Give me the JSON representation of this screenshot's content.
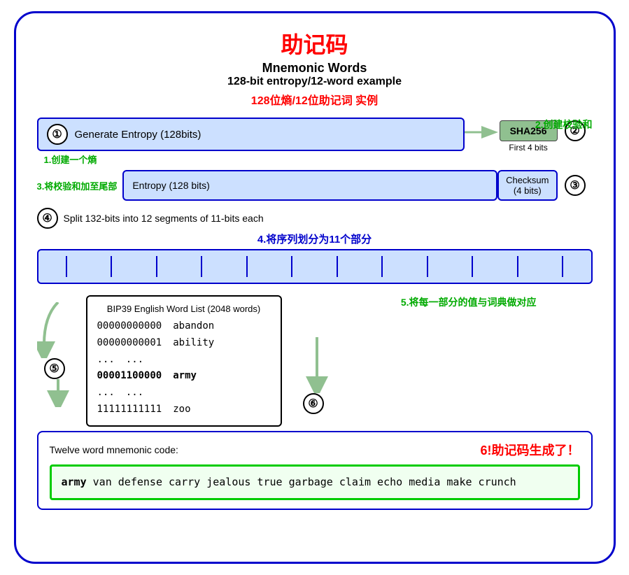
{
  "title": {
    "zh": "助记码",
    "en1": "Mnemonic Words",
    "en2": "128-bit entropy/12-word example",
    "zh2": "128位熵/12位助记词 实例"
  },
  "step1": {
    "number": "①",
    "label": "Generate Entropy (128bits)",
    "annotation": "1.创建一个熵"
  },
  "step2": {
    "number": "②",
    "sha_label": "SHA256",
    "first4bits": "First 4 bits",
    "annotation": "2.创建校验和"
  },
  "step3": {
    "number": "③",
    "annotation": "3.将校验和加至尾部",
    "entropy_label": "Entropy (128 bits)",
    "checksum_label": "Checksum\n(4 bits)"
  },
  "step4": {
    "number": "④",
    "description": "Split 132-bits into 12 segments of 11-bits each",
    "annotation": "4.将序列划分为11个部分",
    "segments": 12
  },
  "step5": {
    "number": "⑤",
    "bip39_title": "BIP39 English Word List (2048 words)",
    "annotation": "5.将每一部分的值与词典做对应",
    "rows": [
      {
        "binary": "00000000000",
        "word": "abandon"
      },
      {
        "binary": "00000000001",
        "word": "ability"
      },
      {
        "binary": "...",
        "word": "..."
      },
      {
        "binary": "00001100000",
        "word": "army",
        "highlight": true
      },
      {
        "binary": "...",
        "word": "..."
      },
      {
        "binary": "11111111111",
        "word": "zoo"
      }
    ]
  },
  "step6": {
    "number": "⑥",
    "annotation": "6!助记码生成了！",
    "output_label": "Twelve word mnemonic code:",
    "mnemonic": "army van defense carry jealous true garbage claim echo media make crunch",
    "first_word": "army"
  }
}
